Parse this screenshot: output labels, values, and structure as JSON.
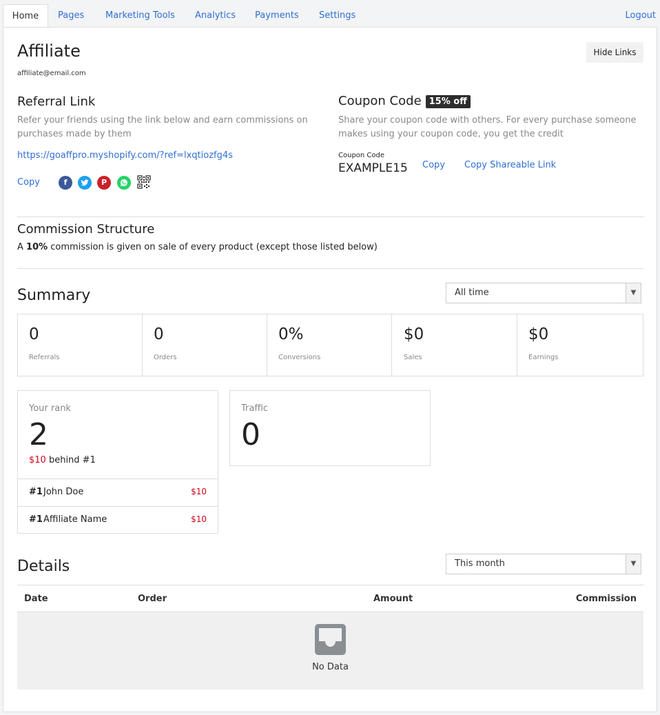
{
  "nav": {
    "tabs": [
      "Home",
      "Pages",
      "Marketing Tools",
      "Analytics",
      "Payments",
      "Settings"
    ],
    "logout": "Logout"
  },
  "header": {
    "title": "Affiliate",
    "email": "affiliate@email.com",
    "hide_links": "Hide Links"
  },
  "referral": {
    "title": "Referral Link",
    "description": "Refer your friends using the link below and earn commissions on purchases made by them",
    "link": "https://goaffpro.myshopify.com/?ref=lxqtiozfg4s",
    "copy": "Copy",
    "share_icons": [
      "facebook-icon",
      "twitter-icon",
      "pinterest-icon",
      "whatsapp-icon",
      "qr-code-icon"
    ]
  },
  "coupon": {
    "title": "Coupon Code",
    "badge": "15% off",
    "description": "Share your coupon code with others. For every purchase someone makes using your coupon code, you get the credit",
    "label": "Coupon Code",
    "code": "EXAMPLE15",
    "copy": "Copy",
    "copy_shareable": "Copy Shareable Link"
  },
  "commission": {
    "title": "Commission Structure",
    "prefix": "A ",
    "rate": "10%",
    "suffix": " commission is given on sale of every product (except those listed below)"
  },
  "summary": {
    "title": "Summary",
    "period": "All time",
    "stats": [
      {
        "value": "0",
        "label": "Referrals"
      },
      {
        "value": "0",
        "label": "Orders"
      },
      {
        "value": "0%",
        "label": "Conversions"
      },
      {
        "value": "$0",
        "label": "Sales"
      },
      {
        "value": "$0",
        "label": "Earnings"
      }
    ]
  },
  "rank": {
    "label": "Your rank",
    "value": "2",
    "behind_amount": "$10",
    "behind_text": " behind #1",
    "leaders": [
      {
        "rank": "#1",
        "name": "John Doe",
        "amount": "$10"
      },
      {
        "rank": "#1",
        "name": "Affiliate Name",
        "amount": "$10"
      }
    ]
  },
  "traffic": {
    "label": "Traffic",
    "value": "0"
  },
  "details": {
    "title": "Details",
    "period": "This month",
    "columns": [
      "Date",
      "Order",
      "Amount",
      "Commission"
    ],
    "empty": "No Data"
  },
  "colors": {
    "link": "#2f6fd0",
    "badge_bg": "#2d2d2d",
    "money_red": "#d0021b",
    "facebook": "#3b5998",
    "twitter": "#1da1f2",
    "pinterest": "#cb2027",
    "whatsapp": "#25d366"
  }
}
